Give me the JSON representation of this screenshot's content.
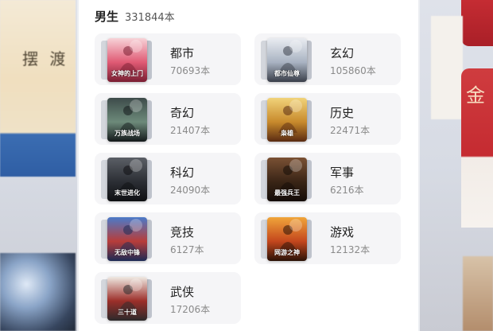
{
  "background": {
    "left_book_title": "摆 渡",
    "left_book_caption": "",
    "right_glyph": "金"
  },
  "section": {
    "title": "男生",
    "count": "331844本"
  },
  "categories": [
    {
      "name": "都市",
      "count": "70693本",
      "cover_text": "女神的上门",
      "cover_colors": [
        "#f7d3d8",
        "#e05a74",
        "#7a1e32"
      ]
    },
    {
      "name": "玄幻",
      "count": "105860本",
      "cover_text": "都市仙尊",
      "cover_colors": [
        "#e9ecf1",
        "#a9b3c2",
        "#3a3f4a"
      ]
    },
    {
      "name": "奇幻",
      "count": "21407本",
      "cover_text": "万族战场",
      "cover_colors": [
        "#3d4b4a",
        "#6d8a7a",
        "#141a1b"
      ]
    },
    {
      "name": "历史",
      "count": "22471本",
      "cover_text": "枭雄",
      "cover_colors": [
        "#f1d37a",
        "#c88a2c",
        "#5a2b12"
      ]
    },
    {
      "name": "科幻",
      "count": "24090本",
      "cover_text": "末世进化",
      "cover_colors": [
        "#5b5f66",
        "#2c2f35",
        "#0e0f12"
      ]
    },
    {
      "name": "军事",
      "count": "6216本",
      "cover_text": "最强兵王",
      "cover_colors": [
        "#7a5134",
        "#3a2516",
        "#140c08"
      ]
    },
    {
      "name": "竞技",
      "count": "6127本",
      "cover_text": "无敌中锋",
      "cover_colors": [
        "#4b7ac9",
        "#b83d3a",
        "#1d2b55"
      ]
    },
    {
      "name": "游戏",
      "count": "12132本",
      "cover_text": "网游之神",
      "cover_colors": [
        "#f0a53a",
        "#c4471d",
        "#2a1207"
      ]
    },
    {
      "name": "武侠",
      "count": "17206本",
      "cover_text": "三十道",
      "cover_colors": [
        "#efe9e2",
        "#9c2f2a",
        "#2c2a2b"
      ]
    }
  ]
}
